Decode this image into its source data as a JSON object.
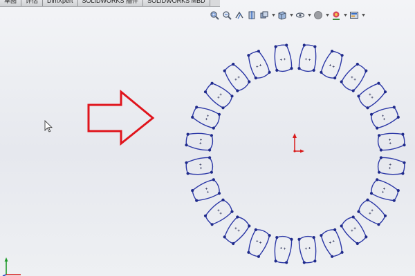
{
  "command_manager": {
    "tabs": [
      {
        "label": "草图",
        "active": false
      },
      {
        "label": "评估",
        "active": false
      },
      {
        "label": "DimXpert",
        "active": false
      },
      {
        "label": "SOLIDWORKS 插件",
        "active": false
      },
      {
        "label": "SOLIDWORKS MBD",
        "active": false
      }
    ]
  },
  "heads_up_toolbar": {
    "buttons": [
      {
        "icon": "zoom-to-fit-icon",
        "dropdown": false
      },
      {
        "icon": "zoom-to-area-icon",
        "dropdown": false
      },
      {
        "icon": "previous-view-icon",
        "dropdown": false
      },
      {
        "icon": "section-view-icon",
        "dropdown": false
      },
      {
        "icon": "view-orientation-icon",
        "dropdown": true
      },
      {
        "icon": "display-style-icon",
        "dropdown": true
      },
      {
        "icon": "hide-show-items-icon",
        "dropdown": true
      },
      {
        "icon": "edit-appearance-icon",
        "dropdown": true
      },
      {
        "icon": "apply-scene-icon",
        "dropdown": true
      },
      {
        "icon": "view-settings-icon",
        "dropdown": true
      }
    ]
  },
  "graphics_area": {
    "annotation": "red-outline-arrow-pointing-right",
    "sketch": {
      "type": "circular-pattern-of-tooth-profiles",
      "tooth_count": 24,
      "origin_marker": "red-sketch-origin",
      "sketch_color": "#2b37a6",
      "endpoint_color": "#1f2a8a",
      "arrow_color": "#e0141c",
      "origin_color": "#d81a1a"
    },
    "cursor": "arrow-pointer",
    "triad": "axis-triad"
  }
}
